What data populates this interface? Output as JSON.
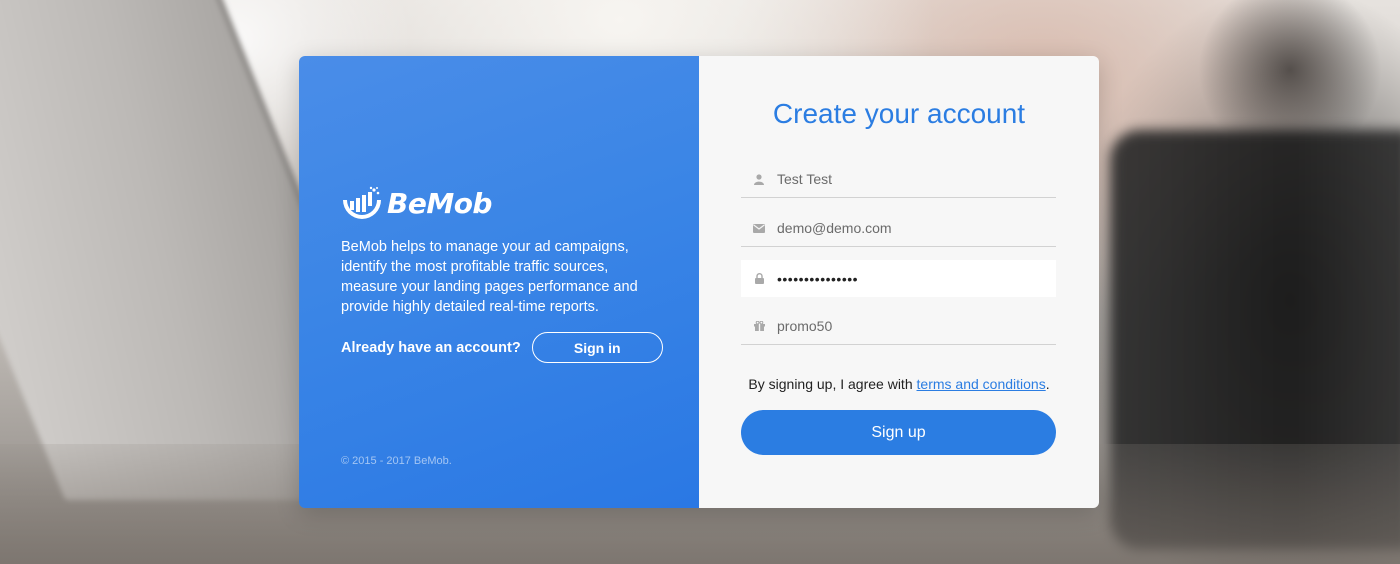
{
  "brand": {
    "name": "BeMob",
    "description": "BeMob helps to manage your ad campaigns, identify the most profitable traffic sources, measure your landing pages performance and provide highly detailed real-time reports.",
    "already_text": "Already have an account?",
    "signin_label": "Sign in",
    "copyright": "© 2015 - 2017 BeMob."
  },
  "form": {
    "title": "Create your account",
    "name_value": "Test Test",
    "email_value": "demo@demo.com",
    "password_value": "•••••••••••••••",
    "promo_value": "promo50",
    "agree_prefix": "By signing up, I agree with ",
    "terms_link": "terms and conditions",
    "agree_suffix": ".",
    "signup_label": "Sign up"
  },
  "colors": {
    "accent": "#2b7de2",
    "panel_left": "#3a85e6",
    "panel_right": "#f7f7f7"
  },
  "icons": {
    "name": "user-icon",
    "email": "envelope-icon",
    "password": "lock-icon",
    "promo": "gift-icon"
  }
}
